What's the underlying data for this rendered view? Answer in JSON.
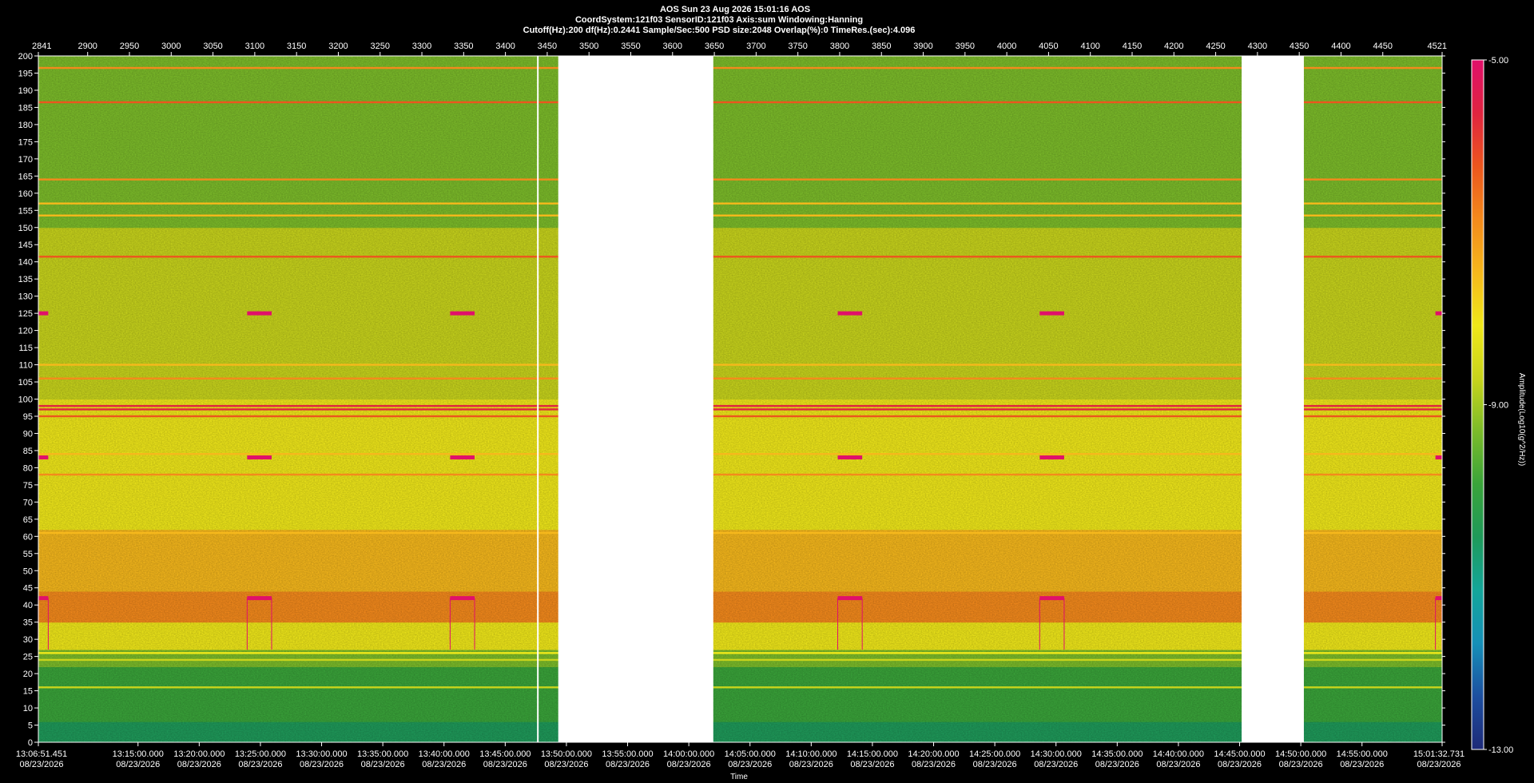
{
  "header": {
    "line1": "AOS  Sun 23 Aug 2026 15:01:16  AOS",
    "line2": "CoordSystem:121f03   SensorID:121f03   Axis:sum    Windowing:Hanning",
    "line3": "Cutoff(Hz):200     df(Hz):0.2441      Sample/Sec:500      PSD size:2048       Overlap(%):0        TimeRes.(sec):4.096"
  },
  "chart_data": {
    "type": "heatmap",
    "title": "AOS  Sun 23 Aug 2026 15:01:16  AOS",
    "xlabel": "Time",
    "ylabel": "",
    "colorbar_label": "Amplitude(Log10(g^2/Hz))",
    "ylim": [
      0,
      200
    ],
    "y_ticks": [
      0,
      5,
      10,
      15,
      20,
      25,
      30,
      35,
      40,
      45,
      50,
      55,
      60,
      65,
      70,
      75,
      80,
      85,
      90,
      95,
      100,
      105,
      110,
      115,
      120,
      125,
      130,
      135,
      140,
      145,
      150,
      155,
      160,
      165,
      170,
      175,
      180,
      185,
      190,
      195,
      200
    ],
    "top_ticks": [
      "2841",
      "2900",
      "2950",
      "3000",
      "3050",
      "3100",
      "3150",
      "3200",
      "3250",
      "3300",
      "3350",
      "3400",
      "3450",
      "3500",
      "3550",
      "3600",
      "3650",
      "3700",
      "3750",
      "3800",
      "3850",
      "3900",
      "3950",
      "4000",
      "4050",
      "4100",
      "4150",
      "4200",
      "4250",
      "4300",
      "4350",
      "4400",
      "4450",
      "4521"
    ],
    "top_range": [
      2841,
      4521
    ],
    "top_tick_values": [
      2841,
      2900,
      2950,
      3000,
      3050,
      3100,
      3150,
      3200,
      3250,
      3300,
      3350,
      3400,
      3450,
      3500,
      3550,
      3600,
      3650,
      3700,
      3750,
      3800,
      3850,
      3900,
      3950,
      4000,
      4050,
      4100,
      4150,
      4200,
      4250,
      4300,
      4350,
      4400,
      4450,
      4521
    ],
    "time_ticks": [
      {
        "time": "13:06:51.451",
        "date": "08/23/2026"
      },
      {
        "time": "13:15:00.000",
        "date": "08/23/2026"
      },
      {
        "time": "13:20:00.000",
        "date": "08/23/2026"
      },
      {
        "time": "13:25:00.000",
        "date": "08/23/2026"
      },
      {
        "time": "13:30:00.000",
        "date": "08/23/2026"
      },
      {
        "time": "13:35:00.000",
        "date": "08/23/2026"
      },
      {
        "time": "13:40:00.000",
        "date": "08/23/2026"
      },
      {
        "time": "13:45:00.000",
        "date": "08/23/2026"
      },
      {
        "time": "13:50:00.000",
        "date": "08/23/2026"
      },
      {
        "time": "13:55:00.000",
        "date": "08/23/2026"
      },
      {
        "time": "14:00:00.000",
        "date": "08/23/2026"
      },
      {
        "time": "14:05:00.000",
        "date": "08/23/2026"
      },
      {
        "time": "14:10:00.000",
        "date": "08/23/2026"
      },
      {
        "time": "14:15:00.000",
        "date": "08/23/2026"
      },
      {
        "time": "14:20:00.000",
        "date": "08/23/2026"
      },
      {
        "time": "14:25:00.000",
        "date": "08/23/2026"
      },
      {
        "time": "14:30:00.000",
        "date": "08/23/2026"
      },
      {
        "time": "14:35:00.000",
        "date": "08/23/2026"
      },
      {
        "time": "14:40:00.000",
        "date": "08/23/2026"
      },
      {
        "time": "14:45:00.000",
        "date": "08/23/2026"
      },
      {
        "time": "14:50:00.000",
        "date": "08/23/2026"
      },
      {
        "time": "14:55:00.000",
        "date": "08/23/2026"
      },
      {
        "time": "15:01:32.731",
        "date": "08/23/2026"
      }
    ],
    "colorbar": {
      "max_label": "-5.00",
      "mid_label": "-9.00",
      "min_label": "-13.00",
      "max": -5,
      "mid": -9,
      "min": -13,
      "stops": [
        "#1e2a78",
        "#1d4fa0",
        "#1690b8",
        "#14a69a",
        "#1f9a5a",
        "#3aa43a",
        "#7cbc2a",
        "#c8d41c",
        "#f0e81a",
        "#f6b81c",
        "#f48a1c",
        "#ec561e",
        "#e02440",
        "#e0106a"
      ]
    },
    "data_gaps": [
      {
        "from": "13:49:20",
        "to": "14:02:00"
      },
      {
        "from": "14:45:10",
        "to": "14:50:15"
      }
    ],
    "cursor_time": "13:47:40",
    "frequency_bands": [
      {
        "from": 0,
        "to": 6,
        "level": -10.8
      },
      {
        "from": 6,
        "to": 14,
        "level": -10.2
      },
      {
        "from": 14,
        "to": 22,
        "level": -9.9
      },
      {
        "from": 22,
        "to": 27,
        "level": -9.5
      },
      {
        "from": 27,
        "to": 35,
        "level": -8.0
      },
      {
        "from": 35,
        "to": 44,
        "level": -6.6
      },
      {
        "from": 44,
        "to": 50,
        "level": -7.6
      },
      {
        "from": 50,
        "to": 62,
        "level": -7.2
      },
      {
        "from": 62,
        "to": 80,
        "level": -8.0
      },
      {
        "from": 80,
        "to": 100,
        "level": -8.3
      },
      {
        "from": 100,
        "to": 125,
        "level": -8.6
      },
      {
        "from": 125,
        "to": 150,
        "level": -8.9
      },
      {
        "from": 150,
        "to": 170,
        "level": -9.1
      },
      {
        "from": 170,
        "to": 185,
        "level": -9.3
      },
      {
        "from": 185,
        "to": 200,
        "level": -9.6
      }
    ],
    "tonal_lines": [
      {
        "hz": 196.5,
        "level": -7.0
      },
      {
        "hz": 186.5,
        "level": -6.0
      },
      {
        "hz": 164,
        "level": -7.0
      },
      {
        "hz": 157,
        "level": -7.2
      },
      {
        "hz": 153.5,
        "level": -7.5
      },
      {
        "hz": 141.5,
        "level": -6.0
      },
      {
        "hz": 110,
        "level": -7.2
      },
      {
        "hz": 106,
        "level": -6.8
      },
      {
        "hz": 98,
        "level": -5.6
      },
      {
        "hz": 97,
        "level": -5.6
      },
      {
        "hz": 95,
        "level": -6.0
      },
      {
        "hz": 84,
        "level": -7.2
      },
      {
        "hz": 78,
        "level": -6.6
      },
      {
        "hz": 61,
        "level": -7.2
      },
      {
        "hz": 26,
        "level": -8.0
      },
      {
        "hz": 24,
        "level": -8.4
      },
      {
        "hz": 16,
        "level": -8.8
      }
    ],
    "transients": [
      {
        "from": "13:06:51",
        "to": "13:07:40",
        "hz": [
          125,
          83,
          42
        ]
      },
      {
        "from": "13:23:55",
        "to": "13:25:55",
        "hz": [
          125,
          83,
          42
        ]
      },
      {
        "from": "13:40:30",
        "to": "13:42:30",
        "hz": [
          125,
          83,
          42
        ]
      },
      {
        "from": "14:12:10",
        "to": "14:14:10",
        "hz": [
          125,
          83,
          42
        ]
      },
      {
        "from": "14:28:40",
        "to": "14:30:40",
        "hz": [
          125,
          83,
          42
        ]
      },
      {
        "from": "15:01:00",
        "to": "15:01:32",
        "hz": [
          125,
          83,
          42
        ]
      }
    ]
  }
}
